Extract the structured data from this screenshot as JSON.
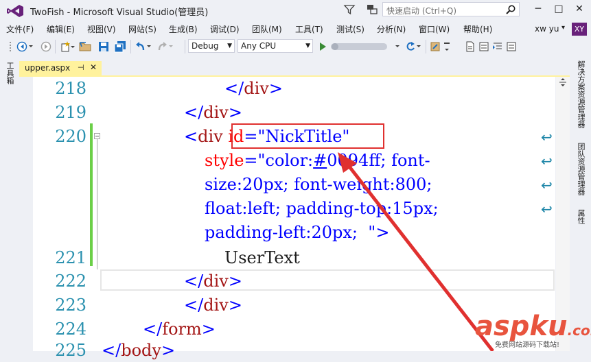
{
  "window": {
    "title": "TwoFish - Microsoft Visual Studio(管理员)"
  },
  "quick_launch": {
    "placeholder": "快速启动 (Ctrl+Q)"
  },
  "window_controls": {
    "minimize": "─",
    "maximize": "□",
    "close": "✕"
  },
  "menu": {
    "items": [
      "文件(F)",
      "编辑(E)",
      "视图(V)",
      "网站(S)",
      "生成(B)",
      "调试(D)",
      "团队(M)",
      "工具(T)",
      "测试(S)",
      "分析(N)",
      "窗口(W)",
      "帮助(H)"
    ]
  },
  "account": {
    "user": "xw yu",
    "caret": "▾",
    "avatar": "XY"
  },
  "toolbar": {
    "configuration": "Debug",
    "platform": "Any CPU"
  },
  "side_panels": {
    "left": "工具箱",
    "right": [
      "解决方案资源管理器",
      "团队资源管理器",
      "属性"
    ]
  },
  "tab": {
    "label": "upper.aspx",
    "pin": "⊣",
    "close": "✕"
  },
  "editor": {
    "line_numbers": [
      "218",
      "219",
      "220",
      "221",
      "222",
      "223",
      "224",
      "225"
    ],
    "lines": {
      "l218": {
        "open": "</",
        "tag": "div",
        "close": ">"
      },
      "l219": {
        "open": "</",
        "tag": "div",
        "close": ">"
      },
      "l220": {
        "open": "<",
        "tag": "div",
        "attr": "id",
        "eq": "=",
        "value": "\"NickTitle\""
      },
      "w1": {
        "attr": "style",
        "eq": "=",
        "value": "\"color:",
        "hash": "#",
        "value2": "0094ff; font-"
      },
      "w2": {
        "text": "size:20px; font-weight:800;"
      },
      "w3": {
        "text": "float:left; padding-top:15px;"
      },
      "w4": {
        "text": "padding-left:20px;  \"",
        "close": ">"
      },
      "l221": {
        "text": "UserText"
      },
      "l222": {
        "open": "</",
        "tag": "div",
        "close": ">"
      },
      "l223": {
        "open": "</",
        "tag": "div",
        "close": ">"
      },
      "l224": {
        "open": "</",
        "tag": "form",
        "close": ">"
      },
      "l225": {
        "open": "</",
        "tag": "body",
        "close": ">"
      }
    },
    "wrap_glyph": "↩"
  },
  "watermark": {
    "brand": "aspku",
    "tld": ".com",
    "tagline": "免费网站源码下载站!"
  },
  "colors": {
    "highlight": "#e0302f",
    "arrow": "#e0302f",
    "accent": "#68217a",
    "tab": "#fff29d",
    "changed_margin": "#6bcf47"
  }
}
